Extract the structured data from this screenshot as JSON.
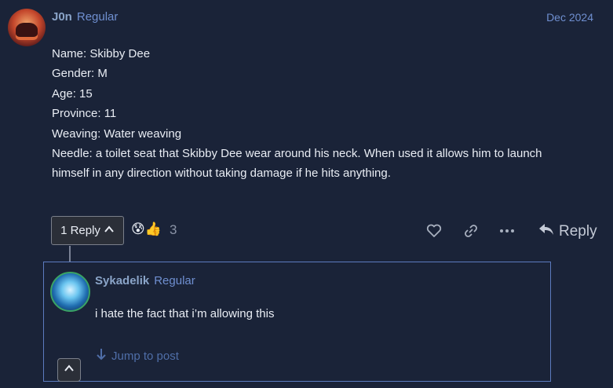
{
  "post": {
    "username": "J0n",
    "user_title": "Regular",
    "date": "Dec 2024",
    "body": [
      "Name: Skibby Dee",
      "Gender: M",
      "Age: 15",
      "Province: 11",
      "Weaving: Water weaving",
      "Needle: a toilet seat that Skibby Dee wear around his neck. When used it allows him to launch",
      "himself in any direction without taking damage if he hits anything."
    ],
    "replies_label": "1 Reply",
    "reactions": [
      "😰",
      "👍"
    ],
    "reaction_count": "3",
    "reply_label": "Reply",
    "icons": {
      "like": "heart-icon",
      "link": "link-icon",
      "more": "ellipsis-icon",
      "reply": "reply-arrow-icon",
      "replies_toggle": "chevron-up-icon"
    }
  },
  "embedded_reply": {
    "username": "Sykadelik",
    "user_title": "Regular",
    "text": "i hate the fact that i’m allowing this",
    "jump_label": "Jump to post"
  },
  "colors": {
    "background": "#1a2338",
    "username": "#8aa4c8",
    "title": "#6f8fd0",
    "text": "#e9edf4",
    "embed_border": "#5c7bbf",
    "link": "#4f6ea8"
  }
}
